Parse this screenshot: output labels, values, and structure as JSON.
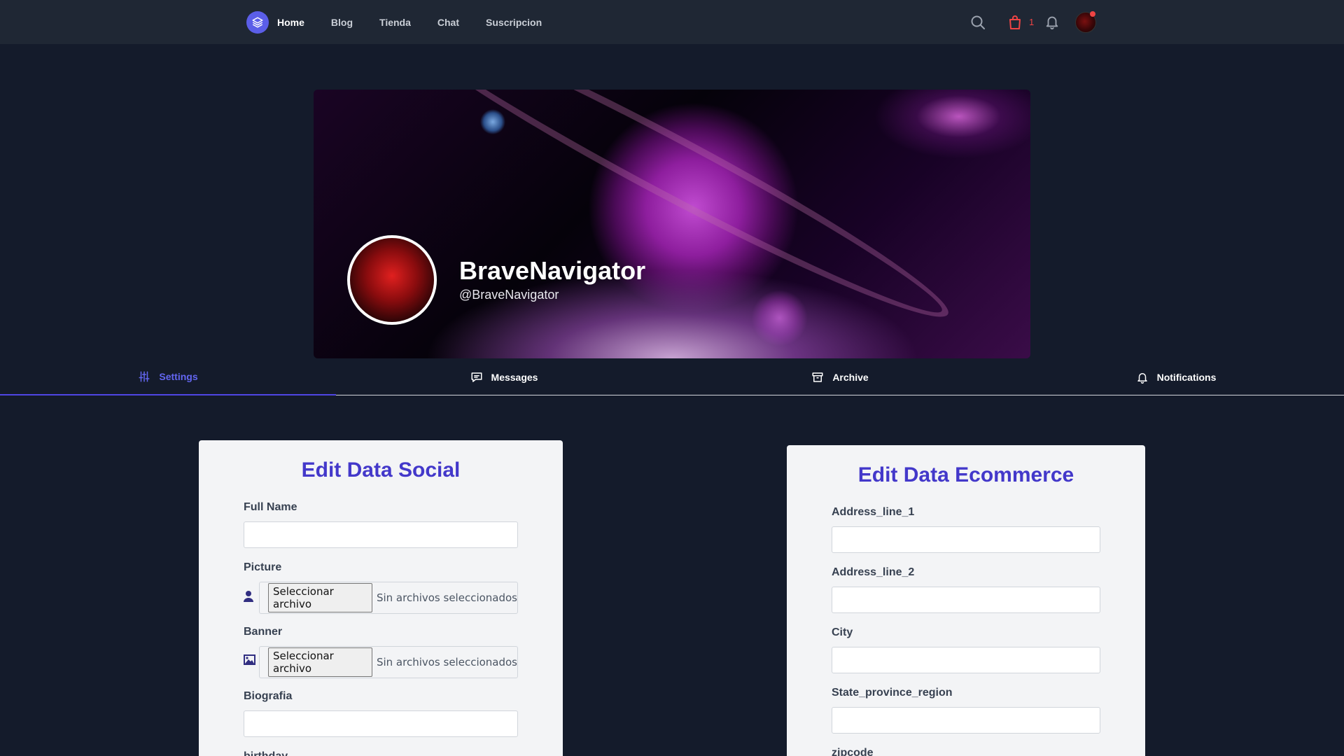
{
  "navbar": {
    "links": [
      "Home",
      "Blog",
      "Tienda",
      "Chat",
      "Suscripcion"
    ],
    "active_link": "Home",
    "cart_count": "1"
  },
  "profile": {
    "name": "BraveNavigator",
    "handle": "@BraveNavigator"
  },
  "tabs": [
    {
      "label": "Settings",
      "icon": "sliders-icon",
      "active": true
    },
    {
      "label": "Messages",
      "icon": "chat-bubble-icon",
      "active": false
    },
    {
      "label": "Archive",
      "icon": "archive-box-icon",
      "active": false
    },
    {
      "label": "Notifications",
      "icon": "bell-icon",
      "active": false
    }
  ],
  "social_form": {
    "title": "Edit Data Social",
    "full_name_label": "Full Name",
    "full_name_value": "",
    "picture_label": "Picture",
    "banner_label": "Banner",
    "biografia_label": "Biografia",
    "biografia_value": "",
    "birthday_label": "birthday",
    "file_button": "Seleccionar archivo",
    "file_status": "Sin archivos seleccionados"
  },
  "ecommerce_form": {
    "title": "Edit Data Ecommerce",
    "address1_label": "Address_line_1",
    "address2_label": "Address_line_2",
    "city_label": "City",
    "state_label": "State_province_region",
    "zipcode_label": "zipcode"
  },
  "colors": {
    "background": "#141b2b",
    "navbar": "#1f2734",
    "accent": "#4f46e5",
    "card": "#f3f4f6",
    "cart": "#ef4444"
  }
}
